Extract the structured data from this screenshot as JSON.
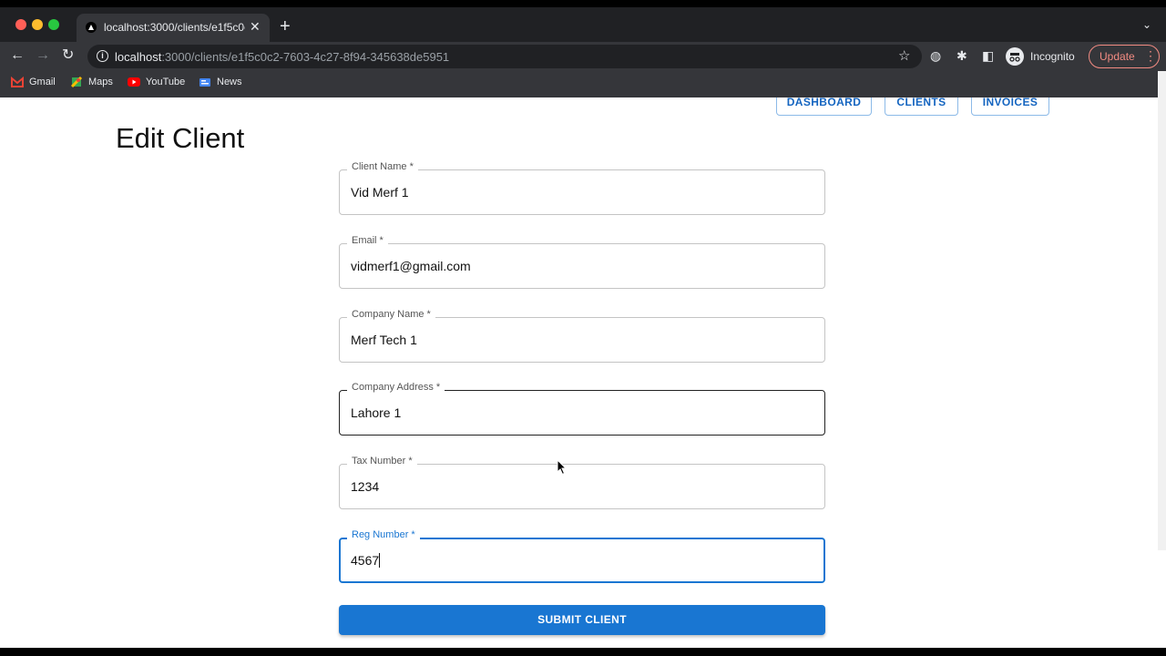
{
  "browser": {
    "tab_title": "localhost:3000/clients/e1f5c0c2-7603-4c27-8f94-345638de5951",
    "url_host": "localhost",
    "url_rest": ":3000/clients/e1f5c0c2-7603-4c27-8f94-345638de5951",
    "profile_label": "Incognito",
    "update_label": "Update",
    "bookmarks": [
      "Gmail",
      "Maps",
      "YouTube",
      "News"
    ]
  },
  "nav": {
    "dashboard": "DASHBOARD",
    "clients": "CLIENTS",
    "invoices": "INVOICES"
  },
  "page": {
    "title": "Edit Client"
  },
  "form": {
    "client_name": {
      "label": "Client Name *",
      "value": "Vid Merf 1"
    },
    "email": {
      "label": "Email *",
      "value": "vidmerf1@gmail.com"
    },
    "company_name": {
      "label": "Company Name *",
      "value": "Merf Tech 1"
    },
    "company_address": {
      "label": "Company Address *",
      "value": "Lahore 1"
    },
    "tax_number": {
      "label": "Tax Number *",
      "value": "1234"
    },
    "reg_number": {
      "label": "Reg Number *",
      "value": "4567"
    },
    "submit_label": "SUBMIT CLIENT"
  },
  "colors": {
    "accent": "#1976d2",
    "chrome_dark": "#202124",
    "update": "#f28b82"
  }
}
